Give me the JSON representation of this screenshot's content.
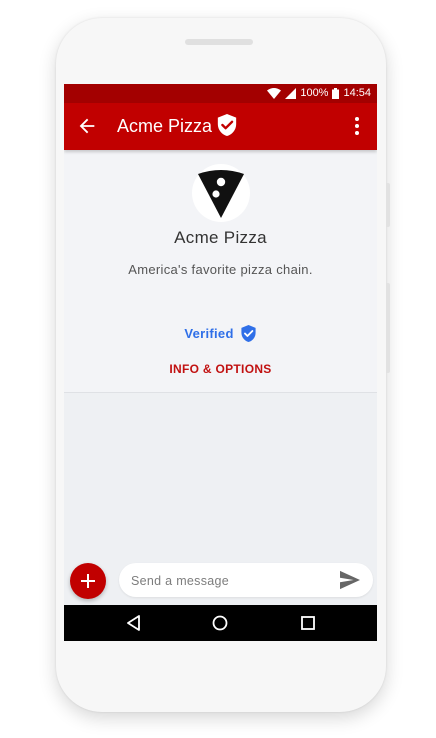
{
  "status_bar": {
    "battery": "100%",
    "time": "14:54"
  },
  "app_bar": {
    "title": "Acme Pizza"
  },
  "profile": {
    "name": "Acme Pizza",
    "tagline": "America's favorite pizza chain.",
    "verified_label": "Verified",
    "info_options_label": "INFO & OPTIONS"
  },
  "compose": {
    "placeholder": "Send a message"
  },
  "colors": {
    "status_bar": "#a30000",
    "app_bar": "#c10000",
    "verified_blue": "#2f6fe8",
    "info_red": "#c11111"
  },
  "icons": {
    "back": "arrow-back-icon",
    "title_badge": "verified-shield-icon",
    "menu": "more-vert-icon",
    "wifi": "wifi-icon",
    "signal": "signal-icon",
    "battery": "battery-icon",
    "logo": "pizza-slice-logo",
    "verified": "verified-shield-icon",
    "add": "plus-icon",
    "send": "send-icon",
    "nav_back": "nav-back-icon",
    "nav_home": "nav-home-icon",
    "nav_recents": "nav-recents-icon"
  }
}
